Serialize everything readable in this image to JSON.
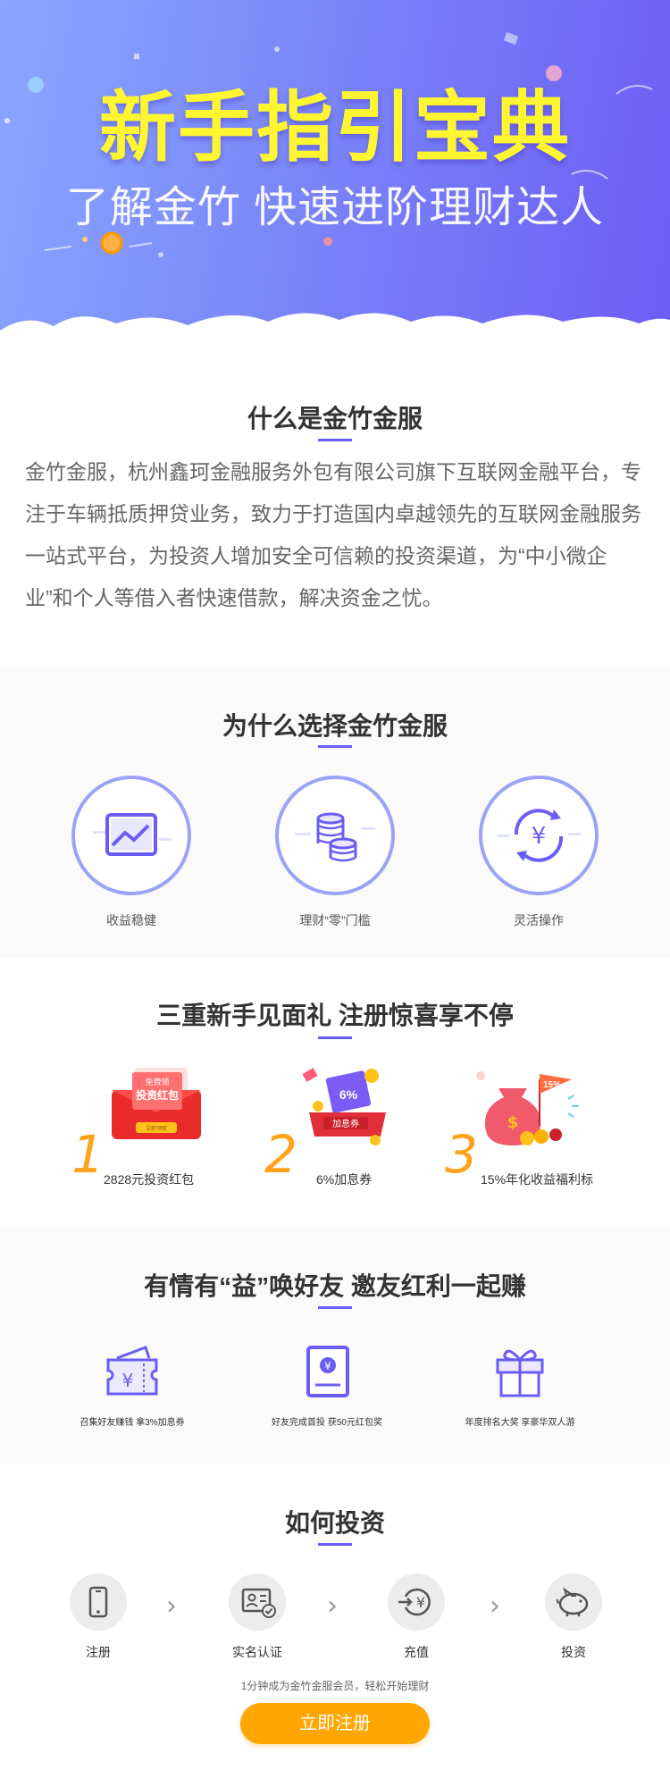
{
  "hero": {
    "title": "新手指引宝典",
    "subtitle": "了解金竹 快速进阶理财达人"
  },
  "about": {
    "title": "什么是金竹金服",
    "text": "金竹金服，杭州鑫珂金融服务外包有限公司旗下互联网金融平台，专注于车辆抵质押贷业务，致力于打造国内卓越领先的互联网金融服务一站式平台，为投资人增加安全可信赖的投资渠道，为“中小微企业”和个人等借入者快速借款，解决资金之忧。"
  },
  "why": {
    "title": "为什么选择金竹金服",
    "items": [
      {
        "label": "收益稳健",
        "icon": "chart-icon"
      },
      {
        "label": "理财“零”门槛",
        "icon": "coins-icon"
      },
      {
        "label": "灵活操作",
        "icon": "yen-cycle-icon"
      }
    ]
  },
  "gifts": {
    "title": "三重新手见面礼  注册惊喜享不停",
    "items": [
      {
        "num": "1",
        "label": "2828元投资红包",
        "img_text": [
          "免费领",
          "投资红包",
          "立即领取"
        ]
      },
      {
        "num": "2",
        "label": "6%加息券",
        "img_text": [
          "6%",
          "加息券"
        ]
      },
      {
        "num": "3",
        "label": "15%年化收益福利标",
        "img_text": [
          "15%"
        ]
      }
    ]
  },
  "invite": {
    "title": "有情有“益”唤好友  邀友红利一起赚",
    "items": [
      {
        "label": "召集好友赚钱 拿3%加息券",
        "icon": "ticket-icon"
      },
      {
        "label": "好友完成首投  获50元红包奖",
        "icon": "red-packet-icon"
      },
      {
        "label": "年度排名大奖  享豪华双人游",
        "icon": "gift-icon"
      }
    ]
  },
  "howto": {
    "title": "如何投资",
    "steps": [
      {
        "label": "注册",
        "icon": "phone-icon"
      },
      {
        "label": "实名认证",
        "icon": "id-card-icon"
      },
      {
        "label": "充值",
        "icon": "yen-deposit-icon"
      },
      {
        "label": "投资",
        "icon": "piggy-bank-icon"
      }
    ],
    "note": "1分钟成为金竹金服会员，轻松开始理财",
    "cta": "立即注册"
  },
  "colors": {
    "accent": "#6a5df5",
    "title_yellow": "#fff531",
    "orange": "#ffa600"
  }
}
